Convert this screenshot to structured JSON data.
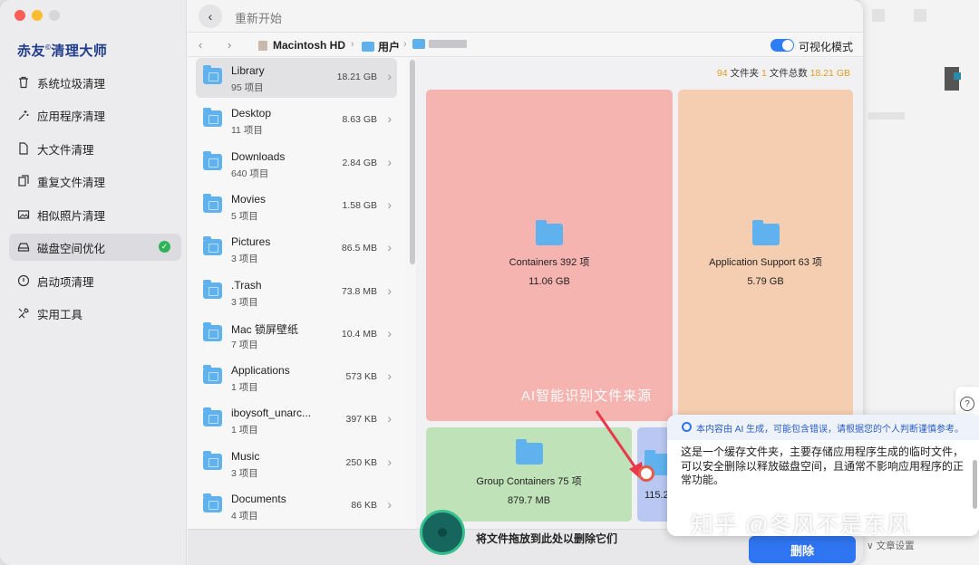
{
  "window": {
    "back_label": "重新开始"
  },
  "sidebar": {
    "brand": "赤友",
    "brand_mark": "©",
    "brand_rest": "清理大师",
    "items": [
      {
        "label": "系统垃圾清理",
        "icon": "trash-icon"
      },
      {
        "label": "应用程序清理",
        "icon": "sparkle-icon"
      },
      {
        "label": "大文件清理",
        "icon": "file-icon"
      },
      {
        "label": "重复文件清理",
        "icon": "duplicate-icon"
      },
      {
        "label": "相似照片清理",
        "icon": "photo-icon"
      },
      {
        "label": "磁盘空间优化",
        "icon": "disk-icon",
        "active": true
      },
      {
        "label": "启动项清理",
        "icon": "power-icon"
      },
      {
        "label": "实用工具",
        "icon": "tools-icon"
      }
    ]
  },
  "pathbar": {
    "crumbs": [
      "Macintosh HD",
      "用户"
    ],
    "toggle_label": "可视化模式"
  },
  "stats": {
    "folders_count": "94",
    "folders_label": "文件夹",
    "files_count": "1",
    "files_label": "文件总数",
    "total_size": "18.21 GB"
  },
  "files": [
    {
      "name": "Library",
      "count": "95 项目",
      "size": "18.21 GB"
    },
    {
      "name": "Desktop",
      "count": "11 项目",
      "size": "8.63 GB"
    },
    {
      "name": "Downloads",
      "count": "640 项目",
      "size": "2.84 GB"
    },
    {
      "name": "Movies",
      "count": "5 项目",
      "size": "1.58 GB"
    },
    {
      "name": "Pictures",
      "count": "3 项目",
      "size": "86.5 MB"
    },
    {
      "name": ".Trash",
      "count": "3 项目",
      "size": "73.8 MB"
    },
    {
      "name": "Mac 锁屏壁纸",
      "count": "7 项目",
      "size": "10.4 MB"
    },
    {
      "name": "Applications",
      "count": "1 项目",
      "size": "573 KB"
    },
    {
      "name": "iboysoft_unarc...",
      "count": "1 项目",
      "size": "397 KB"
    },
    {
      "name": "Music",
      "count": "3 项目",
      "size": "250 KB"
    },
    {
      "name": "Documents",
      "count": "4 项目",
      "size": "86 KB"
    }
  ],
  "treemap": [
    {
      "name": "Containers 392 项",
      "size": "11.06 GB",
      "color": "#f6b4b1"
    },
    {
      "name": "Application Support 63 项",
      "size": "5.79 GB",
      "color": "#f5cdb0"
    },
    {
      "name": "Group Containers 75 项",
      "size": "879.7 MB",
      "color": "#bfe2b8"
    },
    {
      "name": "",
      "size": "115.2",
      "color": "#b9c8f2"
    }
  ],
  "overlay_caption": "AI智能识别文件来源",
  "dropbar": {
    "text": "将文件拖放到此处以删除它们",
    "delete_label": "删除"
  },
  "ai_popup": {
    "notice": "本内容由 AI 生成，可能包含错误，请根据您的个人判断谨慎参考。",
    "body": "这是一个缓存文件夹，主要存储应用程序生成的临时文件，可以安全删除以释放磁盘空间，且通常不影响应用程序的正常功能。"
  },
  "watermark": "知乎 @冬风不是东风",
  "article_settings": "文章设置"
}
